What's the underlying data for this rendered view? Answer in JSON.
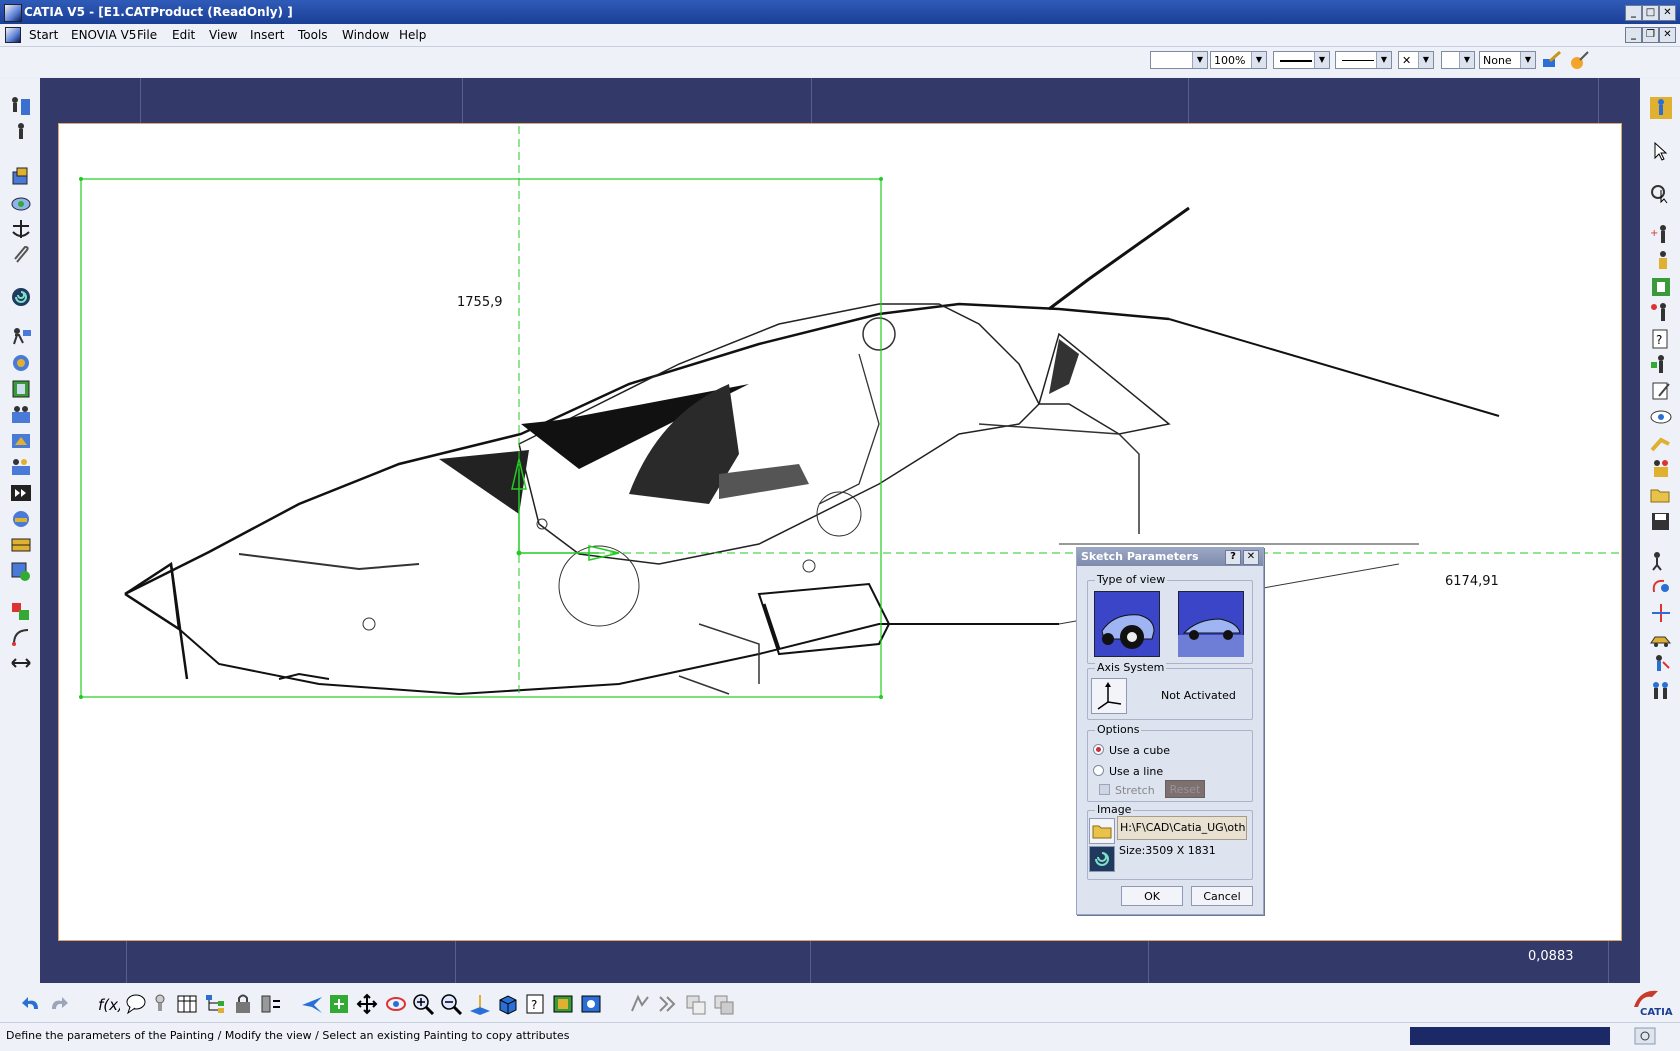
{
  "window": {
    "title": "CATIA V5 - [E1.CATProduct (ReadOnly) ]"
  },
  "menu": [
    "Start",
    "ENOVIA V5",
    "File",
    "Edit",
    "View",
    "Insert",
    "Tools",
    "Window",
    "Help"
  ],
  "toolbar_top": {
    "zoom": "100%",
    "layer": "None"
  },
  "viewport": {
    "dim_vertical": "1755,9",
    "dim_horizontal": "6174,91",
    "scale_readout": "0,0883"
  },
  "dialog": {
    "title": "Sketch Parameters",
    "help_label": "?",
    "close_label": "✕",
    "type_of_view_label": "Type of view",
    "axis_system_label": "Axis System",
    "axis_status": "Not Activated",
    "options_label": "Options",
    "option_cube": "Use a cube",
    "option_line": "Use a line",
    "stretch_label": "Stretch",
    "reset_label": "Reset",
    "image_label": "Image",
    "image_path": "H:\\F\\CAD\\Catia_UG\\other:",
    "image_size": "Size:3509 X 1831",
    "ok_label": "OK",
    "cancel_label": "Cancel"
  },
  "status": {
    "message": "Define the parameters of the Painting / Modify the view / Select an existing Painting to copy attributes"
  },
  "brand": {
    "logo_text": "CATIA"
  },
  "colors": {
    "accent": "#2f5bb8",
    "viewport_bg": "#333a6a",
    "sketch_green": "#22cc22"
  }
}
